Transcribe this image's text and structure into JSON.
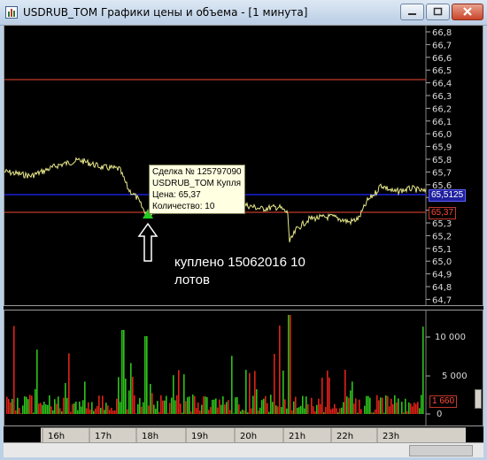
{
  "window": {
    "title": "USDRUB_TOM Графики цены и объема - [1 минута]",
    "buttons": [
      "minimize",
      "restore",
      "close"
    ]
  },
  "price_axis": {
    "ticks": [
      "66,8",
      "66,7",
      "66,6",
      "66,5",
      "66,4",
      "66,3",
      "66,2",
      "66,1",
      "66,0",
      "65,9",
      "65,8",
      "65,7",
      "65,6",
      "65,5",
      "65,4",
      "65,3",
      "65,2",
      "65,1",
      "65,0",
      "64,9",
      "64,8",
      "64,7"
    ]
  },
  "price_markers": {
    "current": "65,5125",
    "deal": "65,37"
  },
  "tooltip": {
    "lines": [
      "Сделка № 125797090",
      "USDRUB_TOM Купля",
      "Цена: 65,37",
      "Количество: 10"
    ]
  },
  "annotation": {
    "line1": "куплено 15062016  10",
    "line2": "лотов"
  },
  "volume_axis": {
    "ticks": [
      "10 000",
      "5 000",
      "0"
    ],
    "current": "1 660"
  },
  "time_axis": {
    "labels": [
      "16h",
      "17h",
      "18h",
      "19h",
      "20h",
      "21h",
      "22h",
      "23h"
    ]
  },
  "colors": {
    "price_line": "#e8e88a",
    "level_line_red": "#c0392b",
    "current_line_blue": "#1e2bff",
    "volume_green": "#2ec21c",
    "volume_red": "#e02218",
    "deal_marker": "#22cc22"
  }
}
